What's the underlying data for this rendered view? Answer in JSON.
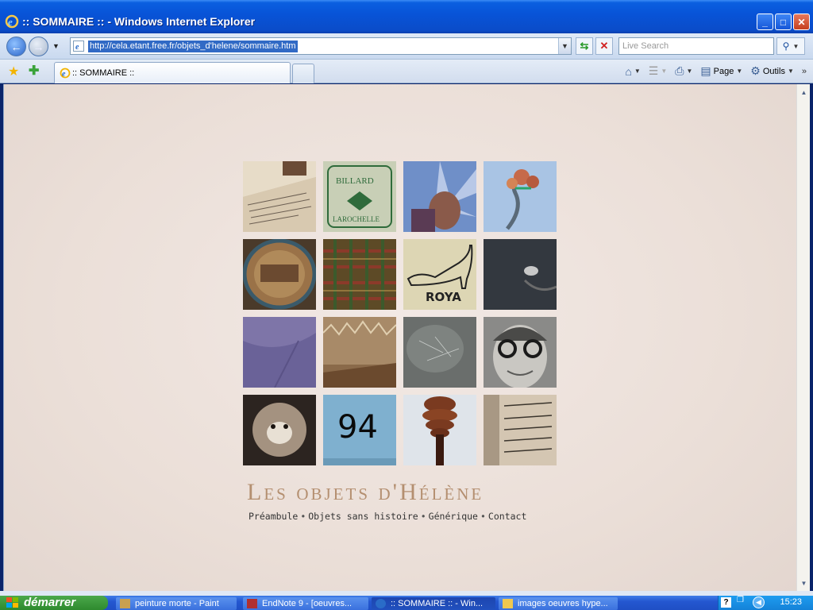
{
  "window": {
    "title": ":: SOMMAIRE :: - Windows Internet Explorer"
  },
  "addressbar": {
    "url": "http://cela.etant.free.fr/objets_d'helene/sommaire.htm",
    "search_placeholder": "Live Search"
  },
  "tabs": [
    {
      "label": ":: SOMMAIRE ::"
    }
  ],
  "commands": {
    "page_label": "Page",
    "tools_label": "Outils"
  },
  "site": {
    "title": "Les objets d'Hélène",
    "nav": [
      {
        "label": "Préambule"
      },
      {
        "label": "Objets sans histoire"
      },
      {
        "label": "Générique"
      },
      {
        "label": "Contact"
      }
    ],
    "tiles": [
      {
        "text": ""
      },
      {
        "text": ""
      },
      {
        "text": ""
      },
      {
        "text": ""
      },
      {
        "text": ""
      },
      {
        "text": ""
      },
      {
        "text": "ROYA"
      },
      {
        "text": ""
      },
      {
        "text": ""
      },
      {
        "text": ""
      },
      {
        "text": ""
      },
      {
        "text": ""
      },
      {
        "text": ""
      },
      {
        "text": "94"
      },
      {
        "text": ""
      },
      {
        "text": ""
      }
    ]
  },
  "taskbar": {
    "start_label": "démarrer",
    "tasks": [
      {
        "label": "peinture morte - Paint"
      },
      {
        "label": "EndNote 9 - [oeuvres..."
      },
      {
        "label": ":: SOMMAIRE :: - Win..."
      },
      {
        "label": "images oeuvres hype..."
      }
    ],
    "clock": "15:23"
  }
}
